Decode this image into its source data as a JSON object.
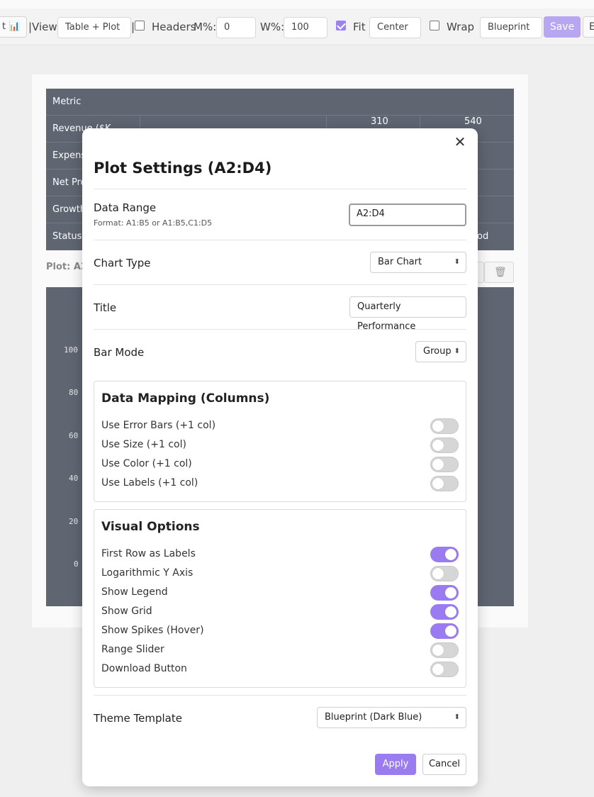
{
  "toolbar": {
    "partial_btn_label": "t 📊",
    "view_label": "|View:",
    "view_value": "Table + Plot",
    "sep": "|",
    "headers_label": "Headers",
    "m_label": "M%:",
    "m_value": "0",
    "w_label": "W%:",
    "w_value": "100",
    "fit_label": "Fit",
    "fit_checked": true,
    "align_value": "Center",
    "wrap_label": "Wrap",
    "theme_value": "Blueprint",
    "save_label": "Save",
    "edge_label": "E"
  },
  "background": {
    "table_rows": [
      "Metric",
      "Revenue ($K",
      "Expens",
      "Net Pro",
      "Growth",
      "Status"
    ],
    "partial_values": [
      "310",
      "540",
      "od"
    ],
    "plot_label": "Plot: A2",
    "y_ticks": [
      "100",
      "80",
      "60",
      "40",
      "20",
      "0"
    ]
  },
  "modal": {
    "title": "Plot Settings (A2:D4)",
    "data_range": {
      "label": "Data Range",
      "hint": "Format: A1:B5 or A1:B5,C1:D5",
      "value": "A2:D4"
    },
    "chart_type": {
      "label": "Chart Type",
      "value": "Bar Chart"
    },
    "title_field": {
      "label": "Title",
      "value": "Quarterly Performance"
    },
    "bar_mode": {
      "label": "Bar Mode",
      "value": "Group"
    },
    "data_mapping": {
      "title": "Data Mapping (Columns)",
      "items": [
        {
          "label": "Use Error Bars (+1 col)",
          "on": false
        },
        {
          "label": "Use Size (+1 col)",
          "on": false
        },
        {
          "label": "Use Color (+1 col)",
          "on": false
        },
        {
          "label": "Use Labels (+1 col)",
          "on": false
        }
      ]
    },
    "visual_options": {
      "title": "Visual Options",
      "items": [
        {
          "label": "First Row as Labels",
          "on": true
        },
        {
          "label": "Logarithmic Y Axis",
          "on": false
        },
        {
          "label": "Show Legend",
          "on": true
        },
        {
          "label": "Show Grid",
          "on": true
        },
        {
          "label": "Show Spikes (Hover)",
          "on": true
        },
        {
          "label": "Range Slider",
          "on": false
        },
        {
          "label": "Download Button",
          "on": false
        }
      ]
    },
    "theme": {
      "label": "Theme Template",
      "value": "Blueprint (Dark Blue)"
    },
    "apply_label": "Apply",
    "cancel_label": "Cancel",
    "close_glyph": "✕"
  },
  "colors": {
    "accent": "#9b7cf0",
    "toggle_off": "#d6d6d6",
    "bg_panel": "#5f6571",
    "save_disabled": "#b9a6f2"
  }
}
